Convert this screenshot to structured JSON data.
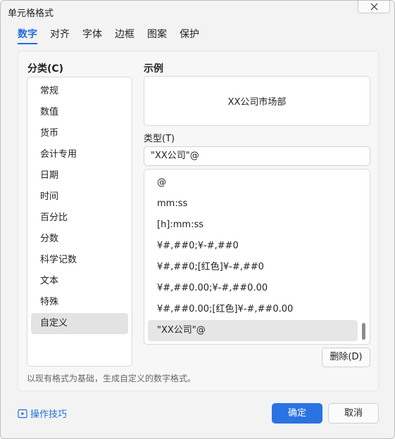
{
  "window": {
    "title": "单元格格式"
  },
  "tabs": [
    {
      "label": "数字",
      "active": true
    },
    {
      "label": "对齐"
    },
    {
      "label": "字体"
    },
    {
      "label": "边框"
    },
    {
      "label": "图案"
    },
    {
      "label": "保护"
    }
  ],
  "category": {
    "label": "分类(C)",
    "items": [
      "常规",
      "数值",
      "货币",
      "会计专用",
      "日期",
      "时间",
      "百分比",
      "分数",
      "科学记数",
      "文本",
      "特殊",
      "自定义"
    ],
    "selected": "自定义"
  },
  "sample": {
    "label": "示例",
    "value": "XX公司市场部"
  },
  "type": {
    "label": "类型(T)",
    "value": "\"XX公司\"@",
    "formats": [
      "@",
      "mm:ss",
      "[h]:mm:ss",
      "¥#,##0;¥-#,##0",
      "¥#,##0;[红色]¥-#,##0",
      "¥#,##0.00;¥-#,##0.00",
      "¥#,##0.00;[红色]¥-#,##0.00",
      "\"XX公司\"@"
    ],
    "selected": "\"XX公司\"@"
  },
  "buttons": {
    "delete": "删除(D)",
    "ok": "确定",
    "cancel": "取消"
  },
  "description": "以现有格式为基础，生成自定义的数字格式。",
  "footer": {
    "tips": "操作技巧"
  },
  "colors": {
    "accent": "#2a73e3",
    "link": "#1f6fde"
  },
  "icons": {
    "close": "close-icon",
    "tips": "play-box-icon"
  }
}
